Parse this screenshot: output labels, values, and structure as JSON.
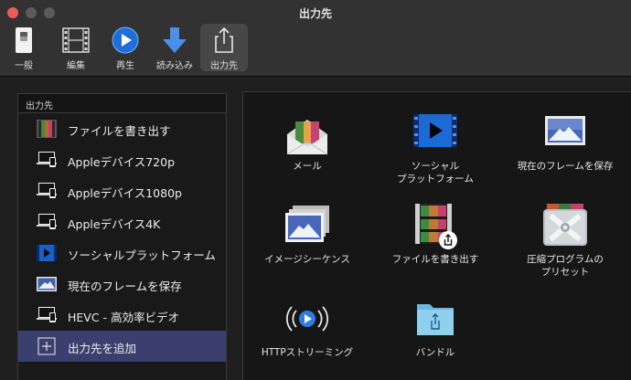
{
  "window": {
    "title": "出力先"
  },
  "toolbar": {
    "items": [
      {
        "label": "一般",
        "icon": "switch-icon"
      },
      {
        "label": "編集",
        "icon": "film-strip-icon"
      },
      {
        "label": "再生",
        "icon": "play-icon"
      },
      {
        "label": "読み込み",
        "icon": "download-arrow-icon"
      },
      {
        "label": "出力先",
        "icon": "share-icon"
      }
    ]
  },
  "sidebar": {
    "header": "出力先",
    "items": [
      {
        "label": "ファイルを書き出す",
        "icon": "film-file-icon"
      },
      {
        "label": "Appleデバイス720p",
        "icon": "devices-icon"
      },
      {
        "label": "Appleデバイス1080p",
        "icon": "devices-icon"
      },
      {
        "label": "Appleデバイス4K",
        "icon": "devices-icon"
      },
      {
        "label": "ソーシャルプラットフォーム",
        "icon": "social-play-icon"
      },
      {
        "label": "現在のフレームを保存",
        "icon": "photo-icon"
      },
      {
        "label": "HEVC - 高効率ビデオ",
        "icon": "devices-icon"
      },
      {
        "label": "出力先を追加",
        "icon": "plus-icon"
      }
    ]
  },
  "destinations": {
    "tiles": [
      {
        "label": "メール",
        "icon": "mail-icon"
      },
      {
        "label": "ソーシャル\nプラットフォーム",
        "icon": "social-play-icon"
      },
      {
        "label": "現在のフレームを保存",
        "icon": "photo-icon"
      },
      {
        "label": "イメージシーケンス",
        "icon": "image-sequence-icon"
      },
      {
        "label": "ファイルを書き出す",
        "icon": "film-share-icon"
      },
      {
        "label": "圧縮プログラムの\nプリセット",
        "icon": "compressor-icon"
      },
      {
        "label": "HTTPストリーミング",
        "icon": "streaming-icon"
      },
      {
        "label": "バンドル",
        "icon": "folder-icon"
      }
    ]
  },
  "colors": {
    "accent": "#2f7de1",
    "selection": "#3b3f6e",
    "close": "#ed5e57"
  }
}
